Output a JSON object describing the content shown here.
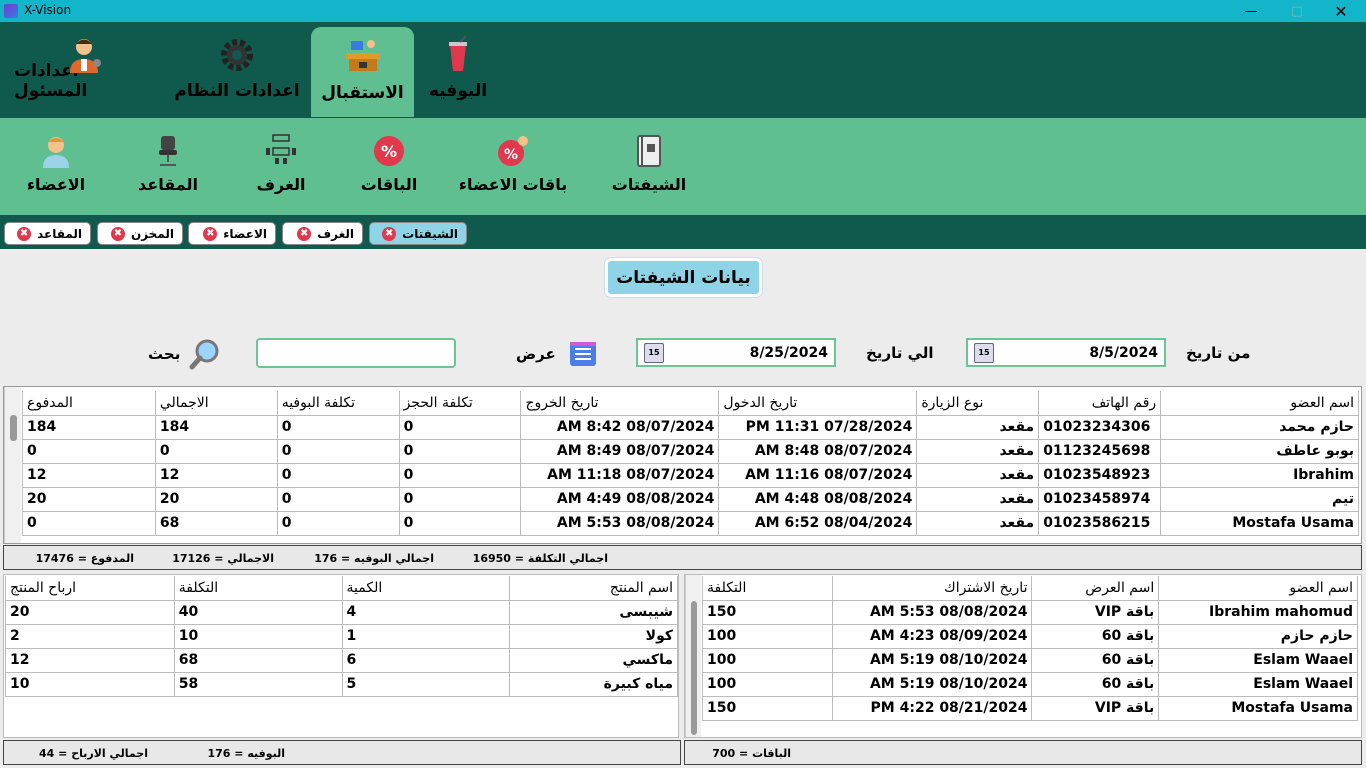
{
  "window": {
    "title": "X-Vision",
    "minimize": "—",
    "maximize": "▢",
    "close": "✕"
  },
  "topnav": [
    {
      "label": "اعدادات المسئول",
      "icon": "admin-settings-icon"
    },
    {
      "label": "اعدادات النظام",
      "icon": "gear-icon"
    },
    {
      "label": "الاستقبال",
      "icon": "reception-desk-icon",
      "active": true
    },
    {
      "label": "البوفيه",
      "icon": "drink-cup-icon"
    }
  ],
  "subnav": [
    {
      "label": "الاعضاء",
      "icon": "member-icon"
    },
    {
      "label": "المقاعد",
      "icon": "office-chair-icon"
    },
    {
      "label": "الغرف",
      "icon": "meeting-room-icon"
    },
    {
      "label": "الباقات",
      "icon": "percent-badge-icon"
    },
    {
      "label": "باقات الاعضاء",
      "icon": "member-percent-icon"
    },
    {
      "label": "الشيفتات",
      "icon": "shifts-book-icon"
    }
  ],
  "tabs": [
    "المقاعد",
    "المخزن",
    "الاعضاء",
    "الغرف",
    "الشيفتات"
  ],
  "page_title": "بيانات الشيفتات",
  "filters": {
    "from_label": "من تاريخ",
    "from_value": "8/5/2024",
    "to_label": "الي تاريخ",
    "to_value": "8/25/2024",
    "show_label": "عرض",
    "search_label": "بحث",
    "search_value": "",
    "calendar_day": "15"
  },
  "shifts": {
    "headers": [
      "اسم العضو",
      "رقم الهاتف",
      "نوع الزيارة",
      "تاريخ الدخول",
      "تاريخ الخروج",
      "تكلفة الحجز",
      "تكلفة البوفيه",
      "الاجمالي",
      "المدفوع"
    ],
    "rows": [
      [
        "حازم محمد",
        "01023234306",
        "مقعد",
        "07/28/2024 11:31 PM",
        "08/07/2024 8:42 AM",
        "0",
        "0",
        "184",
        "184"
      ],
      [
        "بوبو عاطف",
        "01123245698",
        "مقعد",
        "08/07/2024 8:48 AM",
        "08/07/2024 8:49 AM",
        "0",
        "0",
        "0",
        "0"
      ],
      [
        "Ibrahim",
        "01023548923",
        "مقعد",
        "08/07/2024 11:16 AM",
        "08/07/2024 11:18 AM",
        "0",
        "0",
        "12",
        "12"
      ],
      [
        "تيم",
        "01023458974",
        "مقعد",
        "08/08/2024 4:48 AM",
        "08/08/2024 4:49 AM",
        "0",
        "0",
        "20",
        "20"
      ],
      [
        "Mostafa Usama",
        "01023586215",
        "مقعد",
        "08/04/2024 6:52 AM",
        "08/08/2024 5:53 AM",
        "0",
        "0",
        "68",
        "0"
      ]
    ],
    "footer": {
      "cost": "اجمالي التكلفة = 16950",
      "buffet": "اجمالي البوفيه = 176",
      "total": "الاجمالي = 17126",
      "paid": "المدفوع = 17476"
    }
  },
  "products": {
    "headers": [
      "اسم المنتج",
      "الكمية",
      "التكلفة",
      "ارباح المنتج"
    ],
    "rows": [
      [
        "شيبسى",
        "4",
        "40",
        "20"
      ],
      [
        "كولا",
        "1",
        "10",
        "2"
      ],
      [
        "ماكسي",
        "6",
        "68",
        "12"
      ],
      [
        "مياه كبيرة",
        "5",
        "58",
        "10"
      ]
    ],
    "footer": {
      "buffet": "البوفيه = 176",
      "profit": "اجمالي الارباح = 44"
    }
  },
  "packages": {
    "headers": [
      "اسم العضو",
      "اسم العرض",
      "تاريخ الاشتراك",
      "التكلفة"
    ],
    "rows": [
      [
        "Ibrahim mahomud",
        "باقة VIP",
        "08/08/2024 5:53 AM",
        "150"
      ],
      [
        "حازم حازم",
        "باقة 60",
        "08/09/2024 4:23 AM",
        "100"
      ],
      [
        "Eslam Waael",
        "باقة 60",
        "08/10/2024 5:19 AM",
        "100"
      ],
      [
        "Eslam Waael",
        "باقة 60",
        "08/10/2024 5:19 AM",
        "100"
      ],
      [
        "Mostafa Usama",
        "باقة VIP",
        "08/21/2024 4:22 PM",
        "150"
      ]
    ],
    "footer": {
      "total": "الباقات = 700"
    }
  }
}
